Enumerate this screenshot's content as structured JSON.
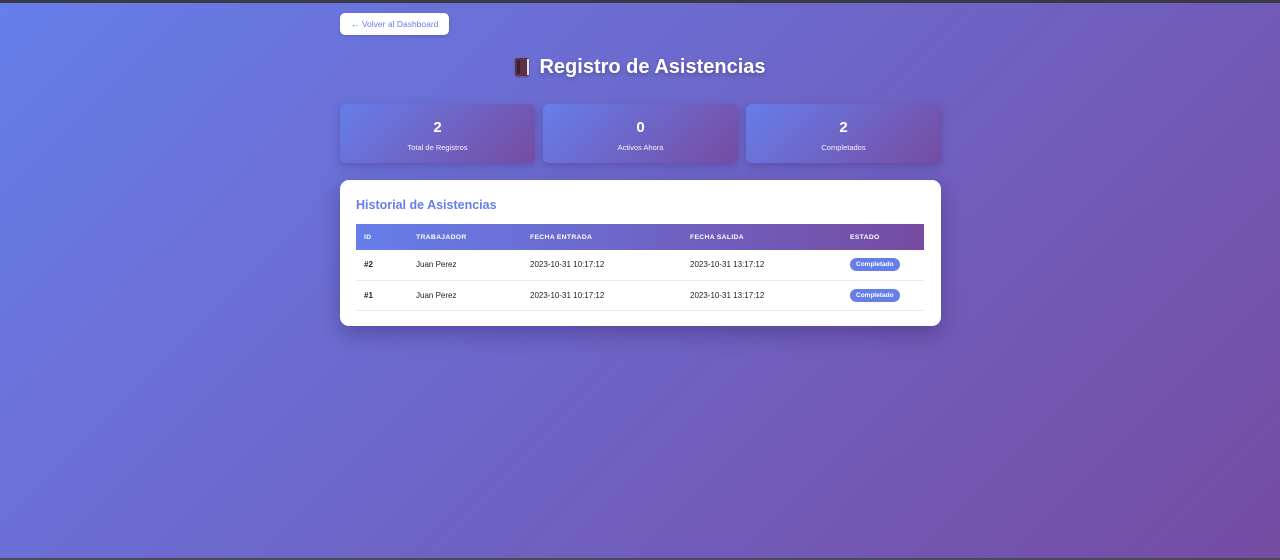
{
  "nav": {
    "back_label": "← Volver al Dashboard"
  },
  "page": {
    "title": "Registro de Asistencias",
    "title_icon": "book-icon"
  },
  "stats": [
    {
      "value": "2",
      "label": "Total de Registros"
    },
    {
      "value": "0",
      "label": "Activos Ahora"
    },
    {
      "value": "2",
      "label": "Completados"
    }
  ],
  "history": {
    "title": "Historial de Asistencias",
    "columns": [
      "ID",
      "TRABAJADOR",
      "FECHA ENTRADA",
      "FECHA SALIDA",
      "ESTADO"
    ],
    "rows": [
      {
        "id": "#2",
        "worker": "Juan Perez",
        "entry": "2023-10-31 10:17:12",
        "exit": "2023-10-31 13:17:12",
        "status": "Completado"
      },
      {
        "id": "#1",
        "worker": "Juan Perez",
        "entry": "2023-10-31 10:17:12",
        "exit": "2023-10-31 13:17:12",
        "status": "Completado"
      }
    ]
  },
  "colors": {
    "gradient_start": "#667eea",
    "gradient_end": "#764ba2",
    "badge": "#667eea"
  }
}
